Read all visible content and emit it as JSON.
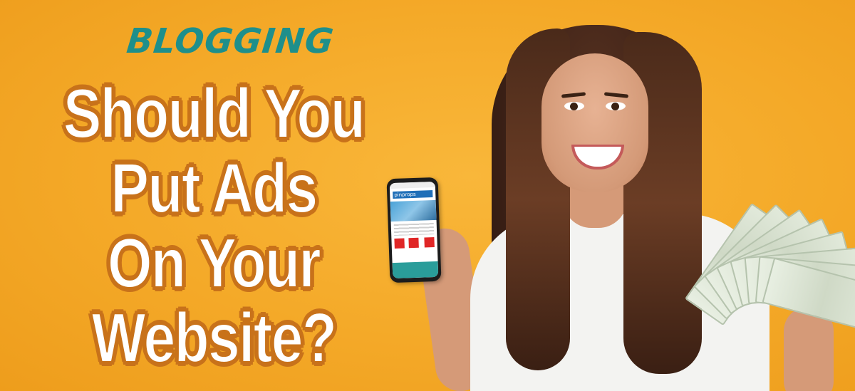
{
  "banner": {
    "category": "BLOGGING",
    "headline_lines": [
      "Should You",
      "Put Ads",
      "On Your",
      "Website?"
    ]
  },
  "colors": {
    "background": "#f4a928",
    "category_text": "#1e8f8b",
    "headline_text": "#ffffff",
    "headline_outline": "#c8721a"
  },
  "phone_screen": {
    "logo_text": "pinprops"
  }
}
